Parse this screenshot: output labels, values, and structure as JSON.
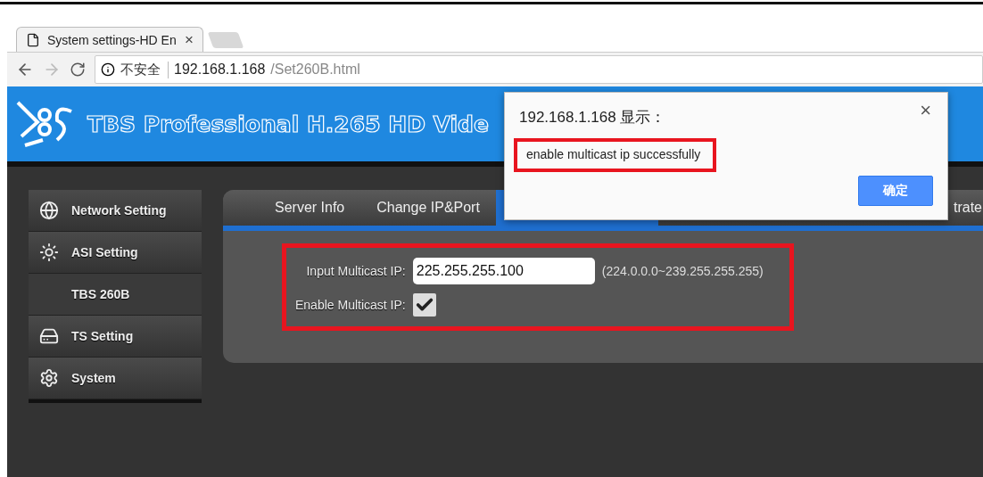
{
  "browser": {
    "tab": {
      "title": "System settings-HD En",
      "close": "×"
    },
    "address": {
      "security": "不安全",
      "host": "192.168.1.168",
      "path": "/Set260B.html"
    }
  },
  "header": {
    "title": "TBS Professional H.265 HD Vide"
  },
  "sidebar": {
    "items": [
      {
        "kind": "globe",
        "label": "Network Setting"
      },
      {
        "kind": "sun",
        "label": "ASI Setting"
      },
      {
        "kind": "plain",
        "label": "TBS 260B"
      },
      {
        "kind": "drive",
        "label": "TS Setting"
      },
      {
        "kind": "gear",
        "label": "System"
      }
    ]
  },
  "tabs": [
    {
      "label": "Server Info",
      "selected": false
    },
    {
      "label": "Change IP&Port",
      "selected": false
    },
    {
      "selected": true
    },
    {
      "label": "trate",
      "selected": false
    }
  ],
  "form": {
    "highlighted": true,
    "multicast_ip": {
      "label": "Input Multicast IP:",
      "value": "225.255.255.100",
      "hint": "(224.0.0.0~239.255.255.255)"
    },
    "enable": {
      "label": "Enable Multicast IP:",
      "checked": true
    }
  },
  "dialog": {
    "title": "192.168.1.168 显示：",
    "message": "enable multicast ip successfully",
    "highlighted": true,
    "close": "×",
    "ok": "确定"
  }
}
